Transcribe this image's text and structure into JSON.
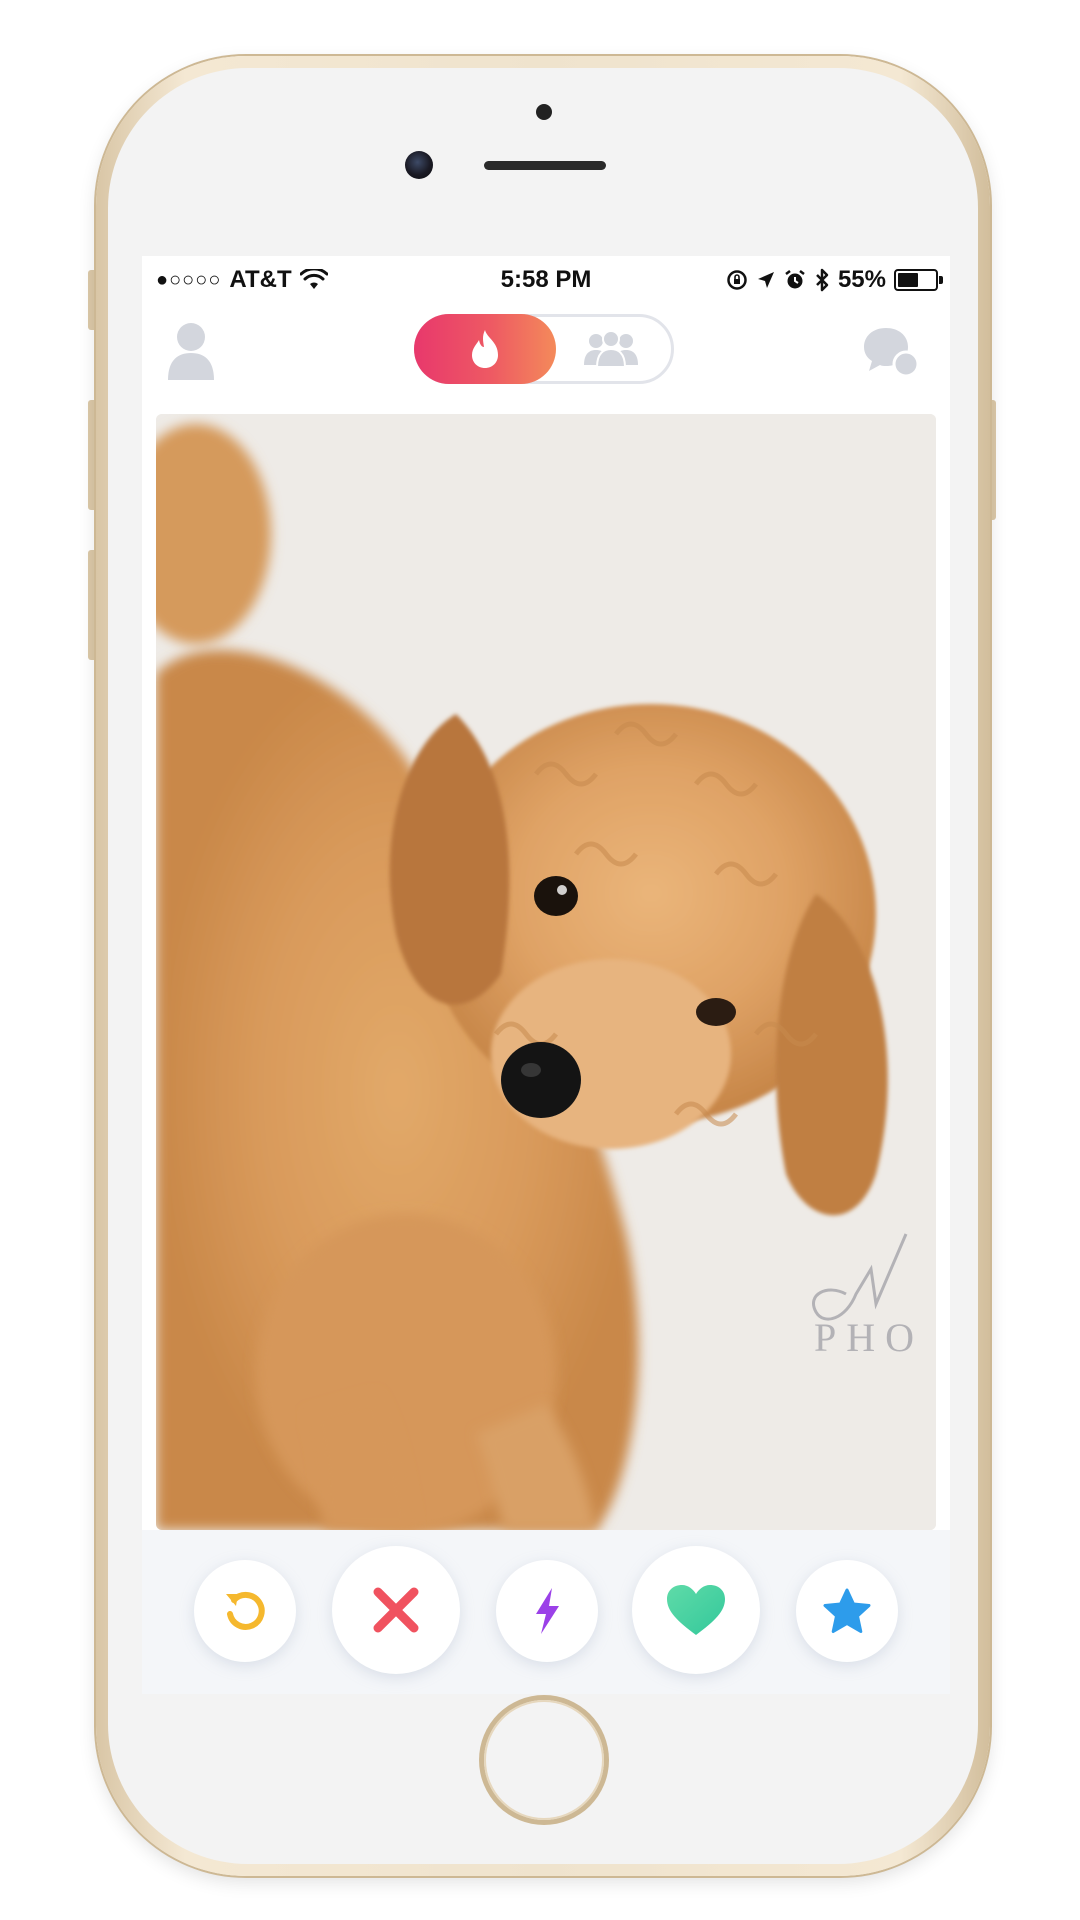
{
  "status_bar": {
    "signal": "●○○○○",
    "carrier": "AT&T",
    "time": "5:58 PM",
    "battery_percent": "55%",
    "battery_level": 0.55,
    "icons": [
      "wifi-icon",
      "rotation-lock-icon",
      "location-icon",
      "alarm-icon",
      "bluetooth-icon",
      "battery-icon"
    ]
  },
  "top_nav": {
    "left_icon": "profile-icon",
    "toggle": {
      "active": "discovery",
      "options": [
        {
          "name": "discovery",
          "icon": "flame-icon"
        },
        {
          "name": "social",
          "icon": "group-icon"
        }
      ]
    },
    "right_icon": "chat-icon"
  },
  "card": {
    "subject": "puppy-photo",
    "watermark": "PHO"
  },
  "actions": [
    {
      "name": "rewind",
      "icon": "rewind-icon",
      "color": "#F5B82E"
    },
    {
      "name": "nope",
      "icon": "close-icon",
      "color": "#F0525F"
    },
    {
      "name": "boost",
      "icon": "lightning-icon",
      "color": "#9B41E8"
    },
    {
      "name": "like",
      "icon": "heart-icon",
      "color": "#48D4A2"
    },
    {
      "name": "super-like",
      "icon": "star-icon",
      "color": "#2D9CEB"
    }
  ],
  "colors": {
    "brand_gradient_start": "#E8386C",
    "brand_gradient_end": "#F48A5A",
    "inactive_icon": "#D3D6DD",
    "phone_gold": "#E9DBC2"
  }
}
